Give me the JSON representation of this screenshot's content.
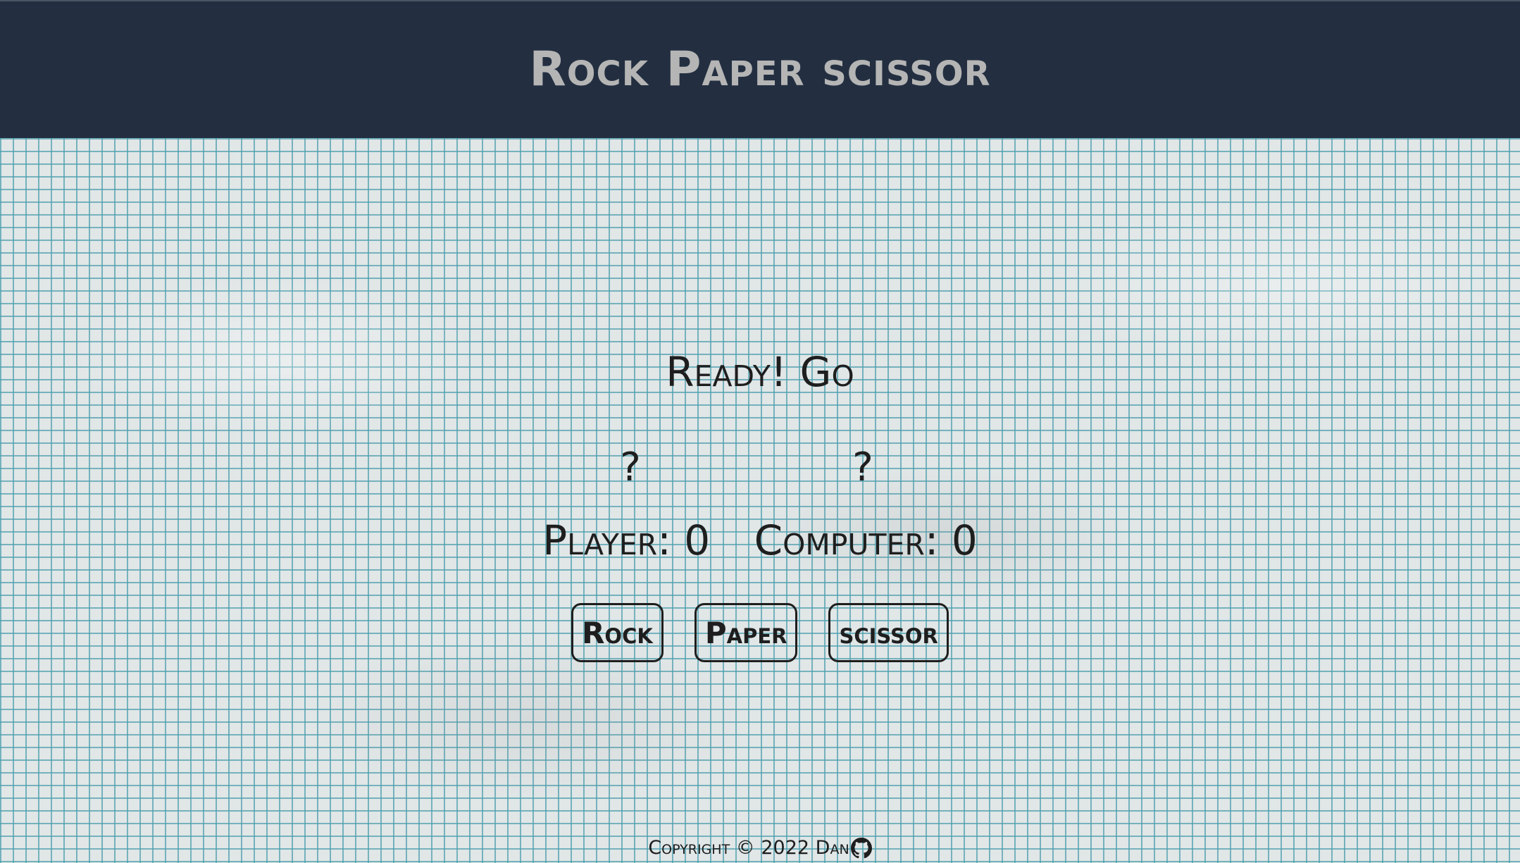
{
  "header": {
    "title": "Rock Paper scissor"
  },
  "game": {
    "status": "Ready! Go",
    "player_choice": "?",
    "computer_choice": "?",
    "player_score": "Player: 0",
    "computer_score": "Computer: 0"
  },
  "buttons": {
    "rock": "Rock",
    "paper": "Paper",
    "scissor": "scissor"
  },
  "footer": {
    "copyright": "Copyright © 2022 Dan",
    "icon": "github-icon"
  },
  "colors": {
    "header_bg": "#232f41",
    "title": "#b5b5b5",
    "grid": "#50a0af",
    "ink": "#1e1e1e"
  }
}
